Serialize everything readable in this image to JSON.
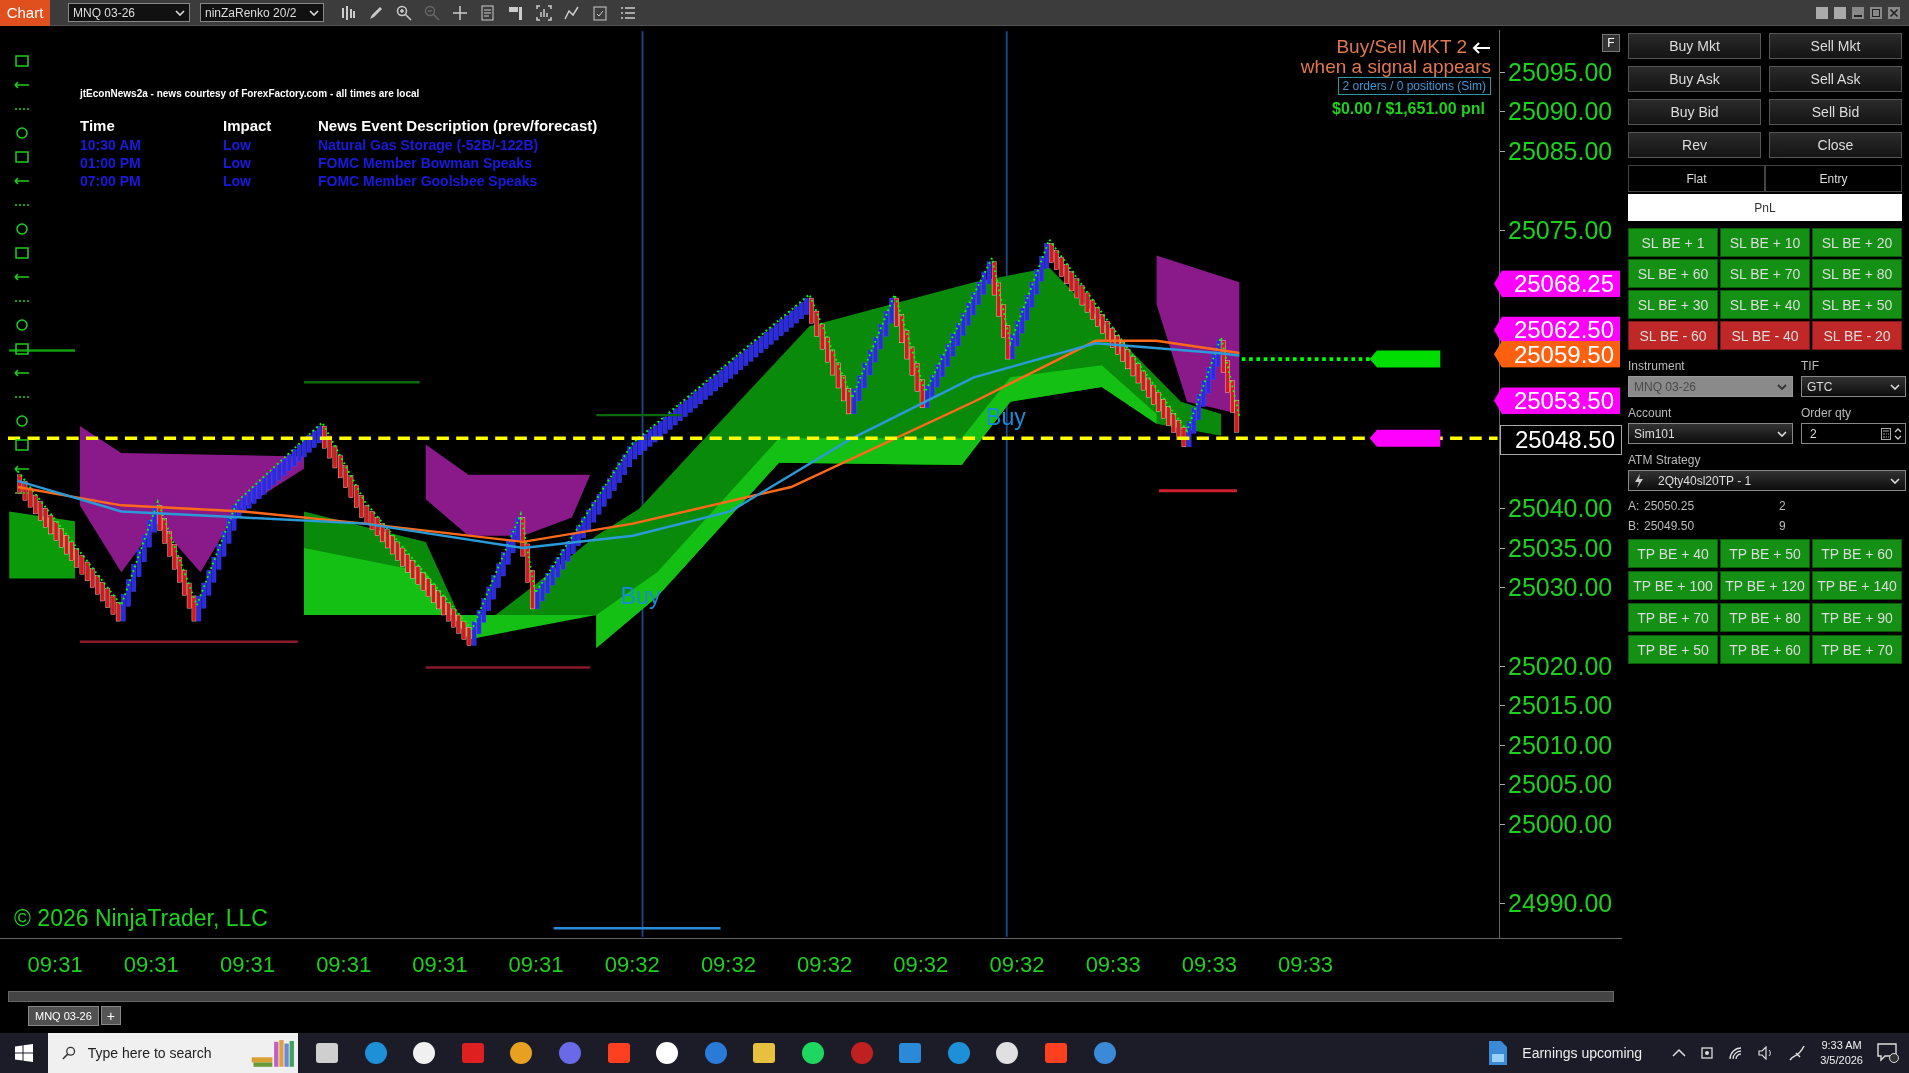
{
  "toolbar": {
    "app_button": "Chart",
    "instrument": "MNQ 03-26",
    "bar_type": "ninZaRenko 20/2"
  },
  "news": {
    "source": "jtEconNews2a - news courtesy of ForexFactory.com - all times are local",
    "columns": [
      "Time",
      "Impact",
      "News Event Description (prev/forecast)"
    ],
    "rows": [
      {
        "time": "10:30 AM",
        "impact": "Low",
        "description": "Natural Gas Storage (-52B/-122B)"
      },
      {
        "time": "01:00 PM",
        "impact": "Low",
        "description": "FOMC Member Bowman Speaks"
      },
      {
        "time": "07:00 PM",
        "impact": "Low",
        "description": "FOMC Member Goolsbee Speaks"
      }
    ]
  },
  "strategy": {
    "title": "Buy/Sell MKT 2",
    "subtitle": "when a signal appears",
    "orders": "2 orders / 0 positions (Sim)",
    "pnl": "$0.00 / $1,651.00 pnl"
  },
  "signals": [
    "Buy",
    "Buy"
  ],
  "price_axis": {
    "labels": [
      "25095.00",
      "25090.00",
      "25085.00",
      "25075.00",
      "25040.00",
      "25035.00",
      "25030.00",
      "25020.00",
      "25015.00",
      "25010.00",
      "25005.00",
      "25000.00",
      "24990.00"
    ],
    "markers": [
      {
        "price": "25068.25",
        "kind": "target"
      },
      {
        "price": "25062.50",
        "kind": "target"
      },
      {
        "price": "25059.50",
        "kind": "stop"
      },
      {
        "price": "25053.50",
        "kind": "target"
      },
      {
        "price": "25048.50",
        "kind": "last"
      }
    ],
    "float_button": "F"
  },
  "time_axis": [
    "09:31",
    "09:31",
    "09:31",
    "09:31",
    "09:31",
    "09:31",
    "09:32",
    "09:32",
    "09:32",
    "09:32",
    "09:32",
    "09:33",
    "09:33",
    "09:33"
  ],
  "copyright": "© 2026 NinjaTrader, LLC",
  "chart_tabs": [
    {
      "label": "MNQ 03-26",
      "selected": true
    }
  ],
  "add_tab": "+",
  "order_panel": {
    "buttons": [
      "Buy Mkt",
      "Sell Mkt",
      "Buy Ask",
      "Sell Ask",
      "Buy Bid",
      "Sell Bid",
      "Rev",
      "Close"
    ],
    "status": [
      "Flat",
      "Entry"
    ],
    "pnl": "PnL",
    "sl_buttons": [
      {
        "label": "SL BE + 1",
        "kind": "profit"
      },
      {
        "label": "SL BE + 10",
        "kind": "profit"
      },
      {
        "label": "SL BE + 20",
        "kind": "profit"
      },
      {
        "label": "SL BE + 60",
        "kind": "profit"
      },
      {
        "label": "SL BE + 70",
        "kind": "profit"
      },
      {
        "label": "SL BE + 80",
        "kind": "profit"
      },
      {
        "label": "SL BE + 30",
        "kind": "profit"
      },
      {
        "label": "SL BE + 40",
        "kind": "profit"
      },
      {
        "label": "SL BE + 50",
        "kind": "profit"
      },
      {
        "label": "SL BE - 60",
        "kind": "loss"
      },
      {
        "label": "SL BE - 40",
        "kind": "loss"
      },
      {
        "label": "SL BE - 20",
        "kind": "loss"
      }
    ],
    "instrument": {
      "label": "Instrument",
      "value": "MNQ 03-26",
      "disabled": true
    },
    "tif": {
      "label": "TIF",
      "value": "GTC"
    },
    "account": {
      "label": "Account",
      "value": "Sim101"
    },
    "order_qty": {
      "label": "Order qty",
      "value": "2"
    },
    "atm_strategy": {
      "label": "ATM Strategy",
      "value": "2Qty40sl20TP - 1"
    },
    "quotes": [
      {
        "side": "A:",
        "price": "25050.25",
        "size": "2"
      },
      {
        "side": "B:",
        "price": "25049.50",
        "size": "9"
      }
    ],
    "tp_buttons": [
      {
        "label": "TP BE + 40",
        "kind": "profit"
      },
      {
        "label": "TP BE + 50",
        "kind": "profit"
      },
      {
        "label": "TP BE + 60",
        "kind": "profit"
      },
      {
        "label": "TP BE + 100",
        "kind": "profit"
      },
      {
        "label": "TP BE + 120",
        "kind": "profit"
      },
      {
        "label": "TP BE + 140",
        "kind": "profit"
      },
      {
        "label": "TP BE + 70",
        "kind": "profit"
      },
      {
        "label": "TP BE + 80",
        "kind": "profit"
      },
      {
        "label": "TP BE + 90",
        "kind": "profit"
      },
      {
        "label": "TP BE + 50",
        "kind": "profit"
      },
      {
        "label": "TP BE + 60",
        "kind": "profit"
      },
      {
        "label": "TP BE + 70",
        "kind": "profit"
      }
    ]
  },
  "taskbar": {
    "search_placeholder": "Type here to search",
    "news": "Earnings upcoming",
    "time": "9:33 AM",
    "date": "3/5/2026"
  }
}
